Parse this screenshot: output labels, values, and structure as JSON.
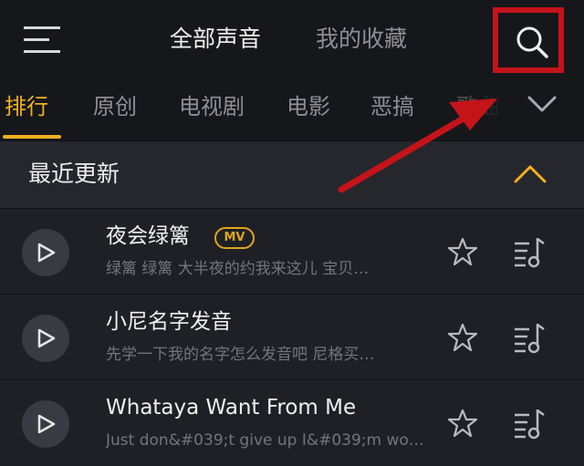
{
  "header": {
    "tabs": [
      {
        "label": "全部声音",
        "active": true
      },
      {
        "label": "我的收藏",
        "active": false
      }
    ]
  },
  "categories": {
    "items": [
      "排行",
      "原创",
      "电视剧",
      "电影",
      "恶搞",
      "歌曲"
    ],
    "active_index": 0
  },
  "section": {
    "title": "最近更新"
  },
  "songs": [
    {
      "title": "夜会绿篱",
      "badge": "MV",
      "subtitle": "绿篱 绿篱 大半夜的约我来这儿 宝贝…"
    },
    {
      "title": "小尼名字发音",
      "badge": "",
      "subtitle": "先学一下我的名字怎么发音吧 尼格买…"
    },
    {
      "title": "Whataya Want From Me",
      "badge": "",
      "subtitle": "Just don&#039;t give up I&#039;m work…"
    }
  ],
  "colors": {
    "accent": "#f2b01e",
    "highlight": "#c4141a",
    "background": "#1c1d22"
  },
  "icons": [
    "menu-icon",
    "search-icon",
    "chevron-down-icon",
    "chevron-up-icon",
    "play-icon",
    "star-icon",
    "playlist-icon"
  ]
}
